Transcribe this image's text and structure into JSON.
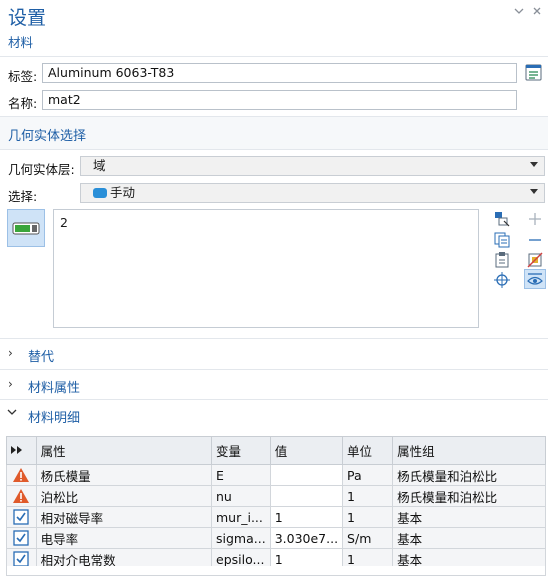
{
  "header": {
    "title": "设置",
    "subtitle": "材料"
  },
  "fields": {
    "label_label": "标签:",
    "label_value": "Aluminum 6063-T83",
    "name_label": "名称:",
    "name_value": "mat2"
  },
  "geometry": {
    "section_title": "几何实体选择",
    "level_label": "几何实体层:",
    "level_value": "域",
    "selection_label": "选择:",
    "selection_value": "手动",
    "selection_list": [
      "2"
    ]
  },
  "sections": {
    "override": "替代",
    "material_properties": "材料属性",
    "material_contents": "材料明细"
  },
  "table": {
    "headers": [
      "",
      "属性",
      "变量",
      "值",
      "单位",
      "属性组"
    ],
    "rows": [
      {
        "status": "warning",
        "property": "杨氏模量",
        "variable": "E",
        "value": "",
        "unit": "Pa",
        "group": "杨氏模量和泊松比"
      },
      {
        "status": "warning",
        "property": "泊松比",
        "variable": "nu",
        "value": "",
        "unit": "1",
        "group": "杨氏模量和泊松比"
      },
      {
        "status": "ok",
        "property": "相对磁导率",
        "variable": "mur_i...",
        "value": "1",
        "unit": "1",
        "group": "基本"
      },
      {
        "status": "ok",
        "property": "电导率",
        "variable": "sigma...",
        "value": "3.030e7...",
        "unit": "S/m",
        "group": "基本"
      },
      {
        "status": "ok",
        "property": "相对介电常数",
        "variable": "epsilo...",
        "value": "1",
        "unit": "1",
        "group": "基本"
      }
    ]
  },
  "colors": {
    "accent": "#1f5fa6",
    "warning": "#e05a2b",
    "check": "#2a6db5"
  }
}
